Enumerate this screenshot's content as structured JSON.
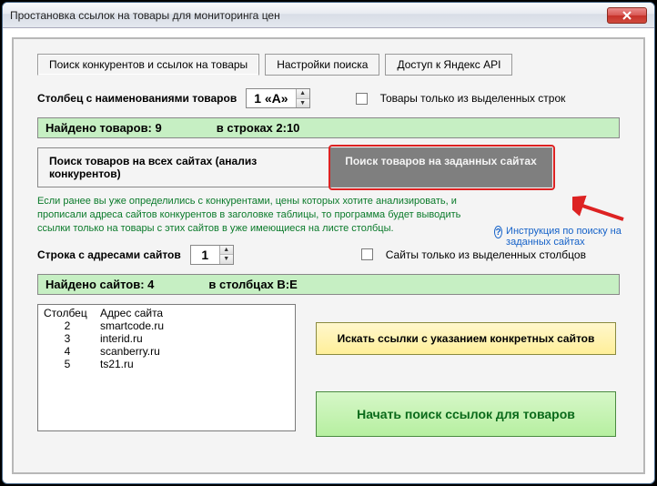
{
  "window": {
    "title": "Простановка ссылок на товары для мониторинга цен"
  },
  "tabs": {
    "tab1": "Поиск конкурентов и ссылок на товары",
    "tab2": "Настройки поиска",
    "tab3": "Доступ к Яндекс API"
  },
  "row_product_col": {
    "label": "Столбец с наименованиями товаров",
    "value": "1 «A»",
    "checkbox_label": "Товары только из выделенных строк"
  },
  "found_products": {
    "count_label": "Найдено товаров: 9",
    "range_label": "в строках 2:10"
  },
  "big_tabs": {
    "left": "Поиск товаров на всех сайтах (анализ конкурентов)",
    "right": "Поиск товаров на заданных сайтах"
  },
  "green_note": "Если ранее вы уже определились с конкурентами, цены которых хотите анализировать, и прописали адреса сайтов конкурентов в заголовке таблицы, то программа будет выводить ссылки только на товары с этих сайтов в уже имеющиеся на листе столбцы.",
  "help_link": "Инструкция по поиску на заданных сайтах",
  "row_sites": {
    "label": "Строка с адресами сайтов",
    "value": "1",
    "checkbox_label": "Сайты только из выделенных столбцов"
  },
  "found_sites": {
    "count_label": "Найдено сайтов: 4",
    "range_label": "в столбцах B:E"
  },
  "list": {
    "col1": "Столбец",
    "col2": "Адрес сайта",
    "rows": [
      {
        "col": "2",
        "site": "smartcode.ru"
      },
      {
        "col": "3",
        "site": "interid.ru"
      },
      {
        "col": "4",
        "site": "scanberry.ru"
      },
      {
        "col": "5",
        "site": "ts21.ru"
      }
    ]
  },
  "buttons": {
    "yellow": "Искать ссылки с указанием конкретных сайтов",
    "green": "Начать поиск ссылок для товаров"
  }
}
